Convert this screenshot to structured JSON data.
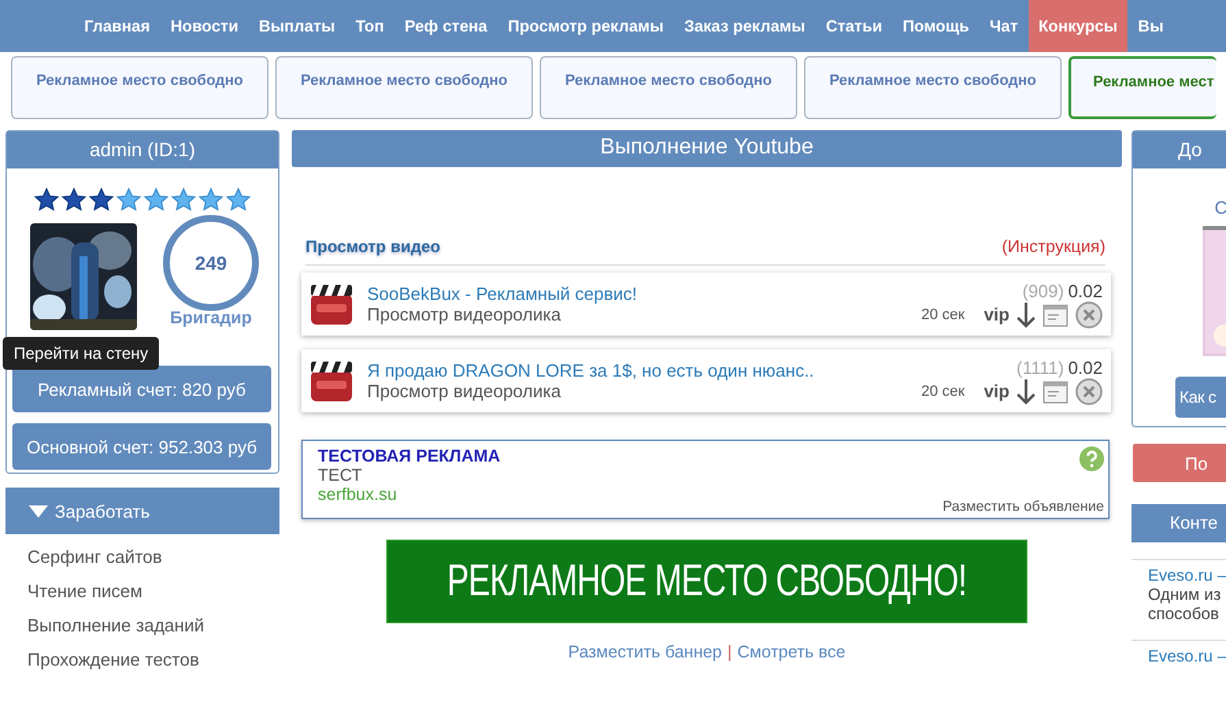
{
  "nav": [
    {
      "label": "Главная",
      "highlighted": false
    },
    {
      "label": "Новости",
      "highlighted": false
    },
    {
      "label": "Выплаты",
      "highlighted": false
    },
    {
      "label": "Топ",
      "highlighted": false
    },
    {
      "label": "Реф стена",
      "highlighted": false
    },
    {
      "label": "Просмотр рекламы",
      "highlighted": false
    },
    {
      "label": "Заказ рекламы",
      "highlighted": false
    },
    {
      "label": "Статьи",
      "highlighted": false
    },
    {
      "label": "Помощь",
      "highlighted": false
    },
    {
      "label": "Чат",
      "highlighted": false
    },
    {
      "label": "Конкурсы",
      "highlighted": true
    },
    {
      "label": "Вы",
      "highlighted": false
    }
  ],
  "ad_slots": [
    {
      "text": "Рекламное место свободно",
      "highlighted": false
    },
    {
      "text": "Рекламное место свободно",
      "highlighted": false
    },
    {
      "text": "Рекламное место свободно",
      "highlighted": false
    },
    {
      "text": "Рекламное место свободно",
      "highlighted": false
    },
    {
      "text": "Рекламное мест",
      "highlighted": true
    }
  ],
  "profile": {
    "title": "admin (ID:1)",
    "stars": 3,
    "level": "249",
    "rank": "Бригадир",
    "tooltip": "Перейти на стену",
    "accounts": [
      "Рекламный счет: 820 руб",
      "Основной счет: 952.303 руб"
    ]
  },
  "earn_menu": {
    "title": "Заработать",
    "expanded": true,
    "items": [
      "Серфинг сайтов",
      "Чтение писем",
      "Выполнение заданий",
      "Прохождение тестов"
    ]
  },
  "main": {
    "title": "Выполнение Youtube",
    "section_title": "Просмотр видео",
    "instruction": "(Инструкция)",
    "tasks": [
      {
        "title": "SooBekBux - Рекламный сервис!",
        "subtitle": "Просмотр видеоролика",
        "count": "(909)",
        "price": "0.02",
        "duration": "20 сек",
        "badge": "vip"
      },
      {
        "title": "Я продаю DRAGON LORE за 1$, но есть один нюанс..",
        "subtitle": "Просмотр видеоролика",
        "count": "(1111)",
        "price": "0.02",
        "duration": "20 сек",
        "badge": "vip"
      }
    ],
    "ad": {
      "title": "ТЕСТОВАЯ РЕКЛАМА",
      "text": "ТЕСТ",
      "url": "serfbux.su",
      "place_link": "Разместить объявление"
    },
    "banner": "РЕКЛАМНОЕ МЕСТО СВОБОДНО!",
    "banner_links": [
      "Разместить баннер",
      "Смотреть все"
    ],
    "separator": "|"
  },
  "right": {
    "title": "До",
    "text": "С",
    "button": "Как с",
    "red_button": "По",
    "contest_title": "Конте",
    "entries": [
      {
        "title": "Eveso.ru –",
        "lines": [
          "Одним из",
          "способов"
        ]
      },
      {
        "title": "Eveso.ru –"
      }
    ]
  }
}
